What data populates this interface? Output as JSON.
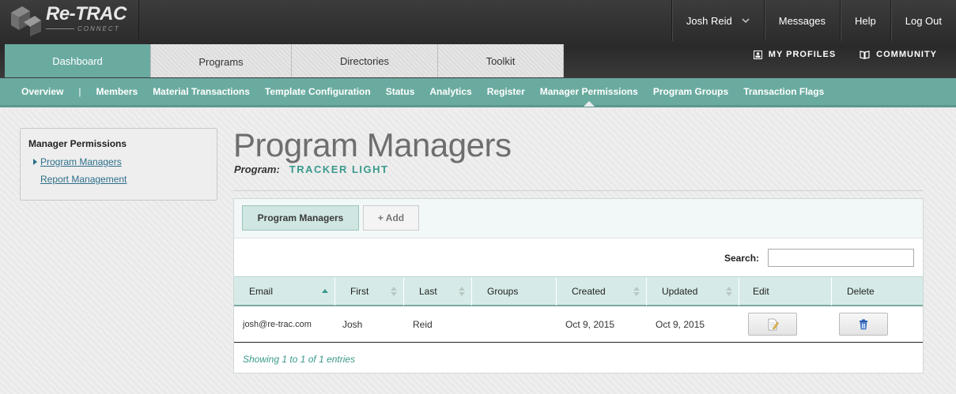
{
  "brand": {
    "name": "Re-TRAC",
    "sub": "CONNECT"
  },
  "topnav": {
    "user": "Josh Reid",
    "messages": "Messages",
    "help": "Help",
    "logout": "Log Out"
  },
  "tabs": [
    {
      "label": "Dashboard"
    },
    {
      "label": "Programs"
    },
    {
      "label": "Directories"
    },
    {
      "label": "Toolkit"
    }
  ],
  "rightlinks": {
    "profiles": "MY PROFILES",
    "community": "COMMUNITY"
  },
  "subnav": {
    "overview": "Overview",
    "separator": "|",
    "items": [
      "Members",
      "Material Transactions",
      "Template Configuration",
      "Status",
      "Analytics",
      "Register",
      "Manager Permissions",
      "Program Groups",
      "Transaction Flags"
    ]
  },
  "sidebar": {
    "title": "Manager Permissions",
    "links": [
      "Program Managers",
      "Report Management"
    ]
  },
  "page": {
    "title": "Program Managers",
    "program_label": "Program:",
    "program_value": "TRACKER LIGHT"
  },
  "panel": {
    "btn_program_managers": "Program Managers",
    "btn_add": "+ Add",
    "search_label": "Search:",
    "search_value": ""
  },
  "table": {
    "columns": [
      "Email",
      "First",
      "Last",
      "Groups",
      "Created",
      "Updated",
      "Edit",
      "Delete"
    ],
    "rows": [
      {
        "email": "josh@re-trac.com",
        "first": "Josh",
        "last": "Reid",
        "groups": "",
        "created": "Oct 9, 2015",
        "updated": "Oct 9, 2015"
      }
    ],
    "info": "Showing 1 to 1 of 1 entries"
  },
  "colors": {
    "accent": "#6aaba0",
    "header_bg": "#333333",
    "link": "#2e6f8a",
    "program": "#3a9a8c"
  }
}
